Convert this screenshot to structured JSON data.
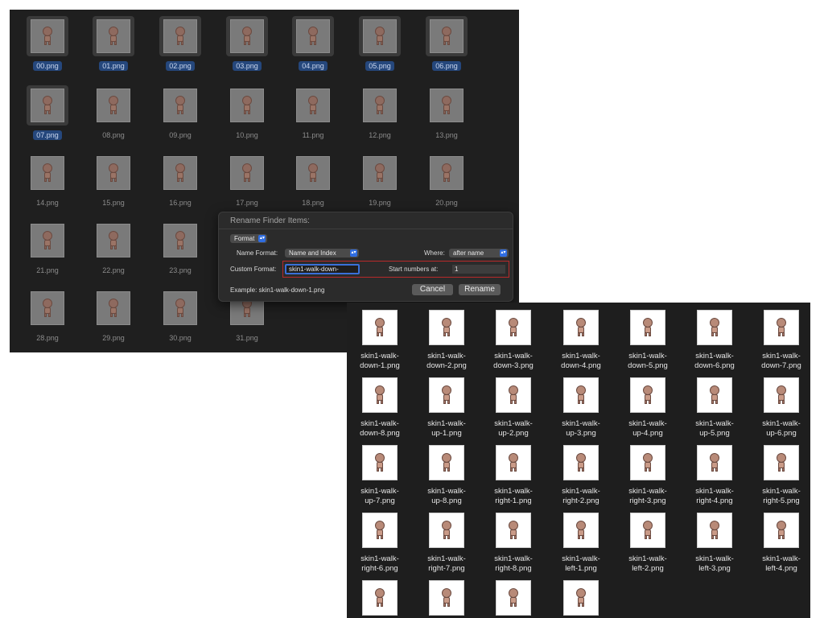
{
  "window_before": {
    "files": [
      {
        "name": "00.png",
        "selected": true
      },
      {
        "name": "01.png",
        "selected": true
      },
      {
        "name": "02.png",
        "selected": true
      },
      {
        "name": "03.png",
        "selected": true
      },
      {
        "name": "04.png",
        "selected": true
      },
      {
        "name": "05.png",
        "selected": true
      },
      {
        "name": "06.png",
        "selected": true
      },
      {
        "name": "07.png",
        "selected": true
      },
      {
        "name": "08.png",
        "selected": false
      },
      {
        "name": "09.png",
        "selected": false
      },
      {
        "name": "10.png",
        "selected": false
      },
      {
        "name": "11.png",
        "selected": false
      },
      {
        "name": "12.png",
        "selected": false
      },
      {
        "name": "13.png",
        "selected": false
      },
      {
        "name": "14.png",
        "selected": false
      },
      {
        "name": "15.png",
        "selected": false
      },
      {
        "name": "16.png",
        "selected": false
      },
      {
        "name": "17.png",
        "selected": false
      },
      {
        "name": "18.png",
        "selected": false
      },
      {
        "name": "19.png",
        "selected": false
      },
      {
        "name": "20.png",
        "selected": false
      },
      {
        "name": "21.png",
        "selected": false
      },
      {
        "name": "22.png",
        "selected": false
      },
      {
        "name": "23.png",
        "selected": false
      },
      {
        "name": "24.png",
        "selected": false
      },
      {
        "name": "25.png",
        "selected": false
      },
      {
        "name": "26.png",
        "selected": false
      },
      {
        "name": "27.png",
        "selected": false
      },
      {
        "name": "28.png",
        "selected": false
      },
      {
        "name": "29.png",
        "selected": false
      },
      {
        "name": "30.png",
        "selected": false
      },
      {
        "name": "31.png",
        "selected": false
      }
    ]
  },
  "dialog": {
    "title": "Rename Finder Items:",
    "mode_popup": "Format",
    "name_format_label": "Name Format:",
    "name_format_value": "Name and Index",
    "where_label": "Where:",
    "where_value": "after name",
    "custom_format_label": "Custom Format:",
    "custom_format_value": "skin1-walk-down-",
    "start_numbers_label": "Start numbers at:",
    "start_numbers_value": "1",
    "example_text": "Example: skin1-walk-down-1.png",
    "cancel_label": "Cancel",
    "rename_label": "Rename"
  },
  "window_after": {
    "files": [
      [
        "skin1-walk-",
        "down-1.png"
      ],
      [
        "skin1-walk-",
        "down-2.png"
      ],
      [
        "skin1-walk-",
        "down-3.png"
      ],
      [
        "skin1-walk-",
        "down-4.png"
      ],
      [
        "skin1-walk-",
        "down-5.png"
      ],
      [
        "skin1-walk-",
        "down-6.png"
      ],
      [
        "skin1-walk-",
        "down-7.png"
      ],
      [
        "skin1-walk-",
        "down-8.png"
      ],
      [
        "skin1-walk-",
        "up-1.png"
      ],
      [
        "skin1-walk-",
        "up-2.png"
      ],
      [
        "skin1-walk-",
        "up-3.png"
      ],
      [
        "skin1-walk-",
        "up-4.png"
      ],
      [
        "skin1-walk-",
        "up-5.png"
      ],
      [
        "skin1-walk-",
        "up-6.png"
      ],
      [
        "skin1-walk-",
        "up-7.png"
      ],
      [
        "skin1-walk-",
        "up-8.png"
      ],
      [
        "skin1-walk-",
        "right-1.png"
      ],
      [
        "skin1-walk-",
        "right-2.png"
      ],
      [
        "skin1-walk-",
        "right-3.png"
      ],
      [
        "skin1-walk-",
        "right-4.png"
      ],
      [
        "skin1-walk-",
        "right-5.png"
      ],
      [
        "skin1-walk-",
        "right-6.png"
      ],
      [
        "skin1-walk-",
        "right-7.png"
      ],
      [
        "skin1-walk-",
        "right-8.png"
      ],
      [
        "skin1-walk-",
        "left-1.png"
      ],
      [
        "skin1-walk-",
        "left-2.png"
      ],
      [
        "skin1-walk-",
        "left-3.png"
      ],
      [
        "skin1-walk-",
        "left-4.png"
      ],
      [
        "",
        ""
      ],
      [
        "",
        ""
      ],
      [
        "",
        ""
      ],
      [
        "",
        ""
      ]
    ]
  },
  "colors": {
    "window_bg": "#1f1f1f",
    "selection": "#25477c",
    "accent": "#2f6de1",
    "highlight_box": "#b82a2a"
  }
}
